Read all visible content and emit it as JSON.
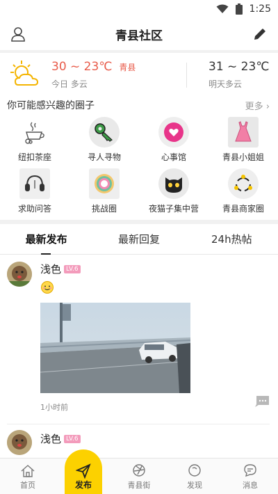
{
  "status": {
    "time": "1:25"
  },
  "header": {
    "title": "青县社区"
  },
  "weather": {
    "today_temp": "30 ~ 23℃",
    "city": "青县",
    "today_desc": "今日 多云",
    "tomorrow_temp": "31 ~ 23℃",
    "tomorrow_desc": "明天多云"
  },
  "circles": {
    "heading": "你可能感兴趣的圈子",
    "more": "更多",
    "items": [
      {
        "label": "纽扣茶座",
        "icon": "teacup-icon"
      },
      {
        "label": "寻人寻物",
        "icon": "key-icon"
      },
      {
        "label": "心事馆",
        "icon": "heart-bubble-icon"
      },
      {
        "label": "青县小姐姐",
        "icon": "dress-icon"
      },
      {
        "label": "求助问答",
        "icon": "headset-icon"
      },
      {
        "label": "挑战圈",
        "icon": "target-icon"
      },
      {
        "label": "夜猫子集中营",
        "icon": "cat-icon"
      },
      {
        "label": "青县商家圈",
        "icon": "share-circle-icon"
      }
    ]
  },
  "tabs": [
    "最新发布",
    "最新回复",
    "24h热帖"
  ],
  "posts": [
    {
      "author": "浅色",
      "level": "LV.6",
      "time": "1小时前"
    },
    {
      "author": "浅色",
      "level": "LV.6"
    }
  ],
  "nav": {
    "home": "首页",
    "publish": "发布",
    "street": "青县街",
    "discover": "发现",
    "messages": "消息"
  },
  "colors": {
    "accent": "#fcd100",
    "temp": "#e85b4a",
    "level_badge": "#f39bbb"
  }
}
